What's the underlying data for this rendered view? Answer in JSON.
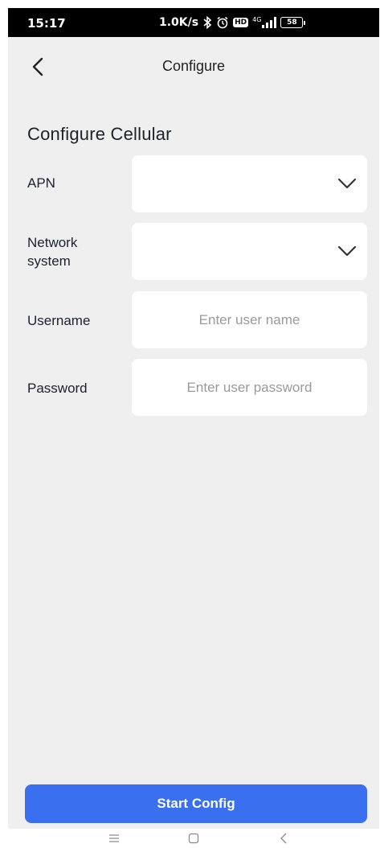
{
  "status_bar": {
    "time": "15:17",
    "network_speed": "1.0K/s",
    "signal_label": "4G",
    "hd_label": "HD",
    "battery": "58",
    "icons": [
      "bluetooth-icon",
      "alarm-icon",
      "hd-icon",
      "signal-icon",
      "battery-icon"
    ]
  },
  "header": {
    "title": "Configure",
    "back_icon": "chevron-left-icon"
  },
  "section": {
    "title": "Configure Cellular"
  },
  "form": {
    "apn": {
      "label": "APN",
      "value": "",
      "icon": "chevron-down-icon"
    },
    "network_system": {
      "label": "Network system",
      "value": "",
      "icon": "chevron-down-icon"
    },
    "username": {
      "label": "Username",
      "value": "",
      "placeholder": "Enter user name"
    },
    "password": {
      "label": "Password",
      "value": "",
      "placeholder": "Enter user password"
    }
  },
  "actions": {
    "start_config_label": "Start Config"
  },
  "nav": {
    "icons": [
      "menu-icon",
      "home-icon",
      "back-icon"
    ]
  },
  "colors": {
    "primary": "#3a6ff0",
    "background": "#efefef",
    "field_background": "#ffffff",
    "text": "#1d2129",
    "placeholder": "#9a9a9a"
  }
}
